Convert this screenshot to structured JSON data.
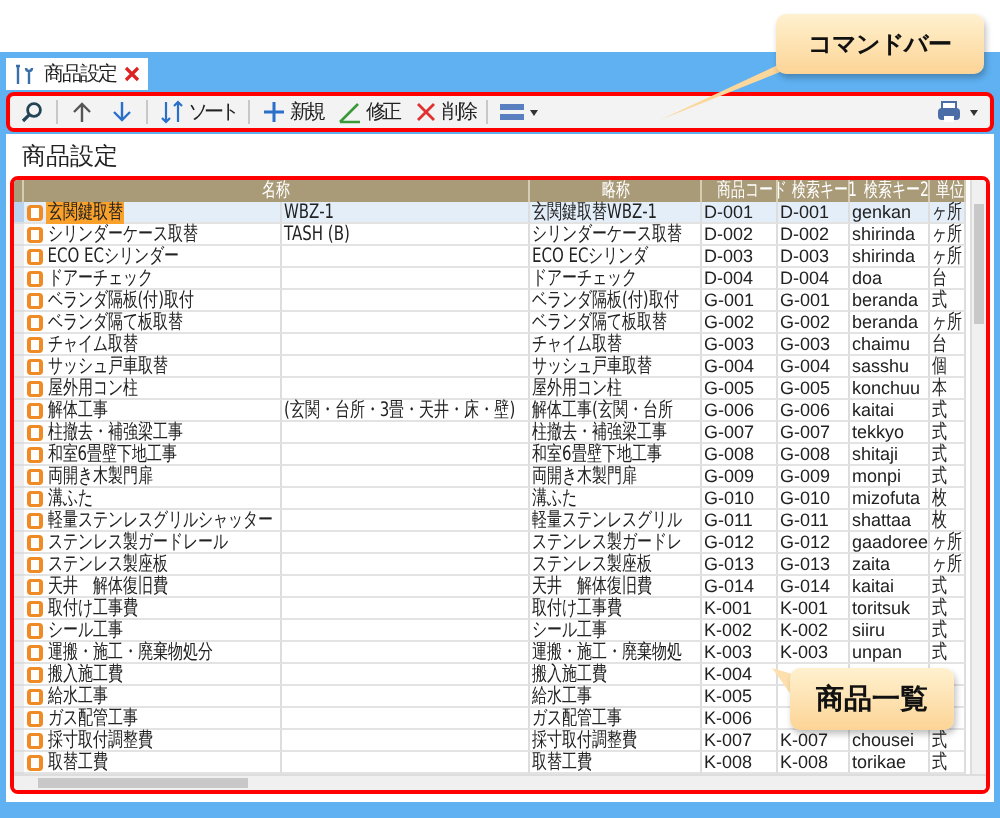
{
  "tab": {
    "label": "商品設定",
    "selected": true
  },
  "toolbar": {
    "left": [
      {
        "kind": "search"
      },
      {
        "kind": "separator"
      },
      {
        "kind": "up"
      },
      {
        "kind": "down"
      },
      {
        "kind": "separator"
      },
      {
        "kind": "sort",
        "label": "ソート"
      },
      {
        "kind": "separator"
      },
      {
        "kind": "add",
        "label": "新規"
      },
      {
        "kind": "edit",
        "label": "修正"
      },
      {
        "kind": "delete",
        "label": "削除"
      },
      {
        "kind": "separator"
      },
      {
        "kind": "view-menu"
      }
    ],
    "right": [
      {
        "kind": "print-menu"
      }
    ]
  },
  "callouts": [
    {
      "kind": "toolbar",
      "text": "コマンドバー"
    },
    {
      "kind": "table",
      "text": "商品一覧"
    }
  ],
  "page_title": "商品設定",
  "table": {
    "columns": [
      "名称",
      "略称",
      "商品コード",
      "検索キー1",
      "検索キー2",
      "単位"
    ],
    "rows": [
      {
        "selected": true,
        "name": "玄関鍵取替",
        "spec": "WBZ-1",
        "short": "玄関鍵取替WBZ-1",
        "code": "D-001",
        "key1": "D-001",
        "key2": "genkan",
        "unit": "ヶ所"
      },
      {
        "selected": false,
        "name": "シリンダーケース取替",
        "spec": "TASH (B)",
        "short": "シリンダーケース取替",
        "code": "D-002",
        "key1": "D-002",
        "key2": "shirinda",
        "unit": "ヶ所"
      },
      {
        "selected": false,
        "name": "ECO ECシリンダー",
        "short": "ECO ECシリンダ",
        "code": "D-003",
        "key1": "D-003",
        "key2": "shirinda",
        "unit": "ヶ所"
      },
      {
        "selected": false,
        "name": "ドアーチェック",
        "short": "ドアーチェック",
        "code": "D-004",
        "key1": "D-004",
        "key2": "doa",
        "unit": "台"
      },
      {
        "selected": false,
        "name": "ベランダ隔板(付)取付",
        "short": "ベランダ隔板(付)取付",
        "code": "G-001",
        "key1": "G-001",
        "key2": "beranda",
        "unit": "式"
      },
      {
        "selected": false,
        "name": "ベランダ隔て板取替",
        "short": "ベランダ隔て板取替",
        "code": "G-002",
        "key1": "G-002",
        "key2": "beranda",
        "unit": "ヶ所"
      },
      {
        "selected": false,
        "name": "チャイム取替",
        "short": "チャイム取替",
        "code": "G-003",
        "key1": "G-003",
        "key2": "chaimu",
        "unit": "台"
      },
      {
        "selected": false,
        "name": "サッシュ戸車取替",
        "short": "サッシュ戸車取替",
        "code": "G-004",
        "key1": "G-004",
        "key2": "sasshu",
        "unit": "個"
      },
      {
        "selected": false,
        "name": "屋外用コン柱",
        "short": "屋外用コン柱",
        "code": "G-005",
        "key1": "G-005",
        "key2": "konchuu",
        "unit": "本"
      },
      {
        "selected": false,
        "name": "解体工事",
        "spec": "(玄関・台所・3畳・天井・床・壁)",
        "short": "解体工事(玄関・台所",
        "code": "G-006",
        "key1": "G-006",
        "key2": "kaitai",
        "unit": "式"
      },
      {
        "selected": false,
        "name": "柱撤去・補強梁工事",
        "short": "柱撤去・補強梁工事",
        "code": "G-007",
        "key1": "G-007",
        "key2": "tekkyo",
        "unit": "式"
      },
      {
        "selected": false,
        "name": "和室6畳壁下地工事",
        "short": "和室6畳壁下地工事",
        "code": "G-008",
        "key1": "G-008",
        "key2": "shitaji",
        "unit": "式"
      },
      {
        "selected": false,
        "name": "両開き木製門扉",
        "short": "両開き木製門扉",
        "code": "G-009",
        "key1": "G-009",
        "key2": "monpi",
        "unit": "式"
      },
      {
        "selected": false,
        "name": "溝ふた",
        "short": "溝ふた",
        "code": "G-010",
        "key1": "G-010",
        "key2": "mizofuta",
        "unit": "枚"
      },
      {
        "selected": false,
        "name": "軽量ステンレスグリルシャッター",
        "short": "軽量ステンレスグリル",
        "code": "G-011",
        "key1": "G-011",
        "key2": "shattaa",
        "unit": "枚"
      },
      {
        "selected": false,
        "name": "ステンレス製ガードレール",
        "short": "ステンレス製ガードレ",
        "code": "G-012",
        "key1": "G-012",
        "key2": "gaadoree",
        "unit": "ヶ所"
      },
      {
        "selected": false,
        "name": "ステンレス製座板",
        "short": "ステンレス製座板",
        "code": "G-013",
        "key1": "G-013",
        "key2": "zaita",
        "unit": "ヶ所"
      },
      {
        "selected": false,
        "name": "天井　解体復旧費",
        "short": "天井　解体復旧費",
        "code": "G-014",
        "key1": "G-014",
        "key2": "kaitai",
        "unit": "式"
      },
      {
        "selected": false,
        "name": "取付け工事費",
        "short": "取付け工事費",
        "code": "K-001",
        "key1": "K-001",
        "key2": "toritsuk",
        "unit": "式"
      },
      {
        "selected": false,
        "name": "シール工事",
        "short": "シール工事",
        "code": "K-002",
        "key1": "K-002",
        "key2": "siiru",
        "unit": "式"
      },
      {
        "selected": false,
        "name": "運搬・施工・廃棄物処分",
        "short": "運搬・施工・廃棄物処",
        "code": "K-003",
        "key1": "K-003",
        "key2": "unpan",
        "unit": "式"
      },
      {
        "selected": false,
        "name": "搬入施工費",
        "short": "搬入施工費",
        "code": "K-004"
      },
      {
        "selected": false,
        "name": "給水工事",
        "short": "給水工事",
        "code": "K-005"
      },
      {
        "selected": false,
        "name": "ガス配管工事",
        "short": "ガス配管工事",
        "code": "K-006"
      },
      {
        "selected": false,
        "name": "採寸取付調整費",
        "short": "採寸取付調整費",
        "code": "K-007",
        "key1": "K-007",
        "key2": "chousei",
        "unit": "式"
      },
      {
        "selected": false,
        "name": "取替工費",
        "short": "取替工費",
        "code": "K-008",
        "key1": "K-008",
        "key2": "torikae",
        "unit": "式"
      }
    ]
  }
}
